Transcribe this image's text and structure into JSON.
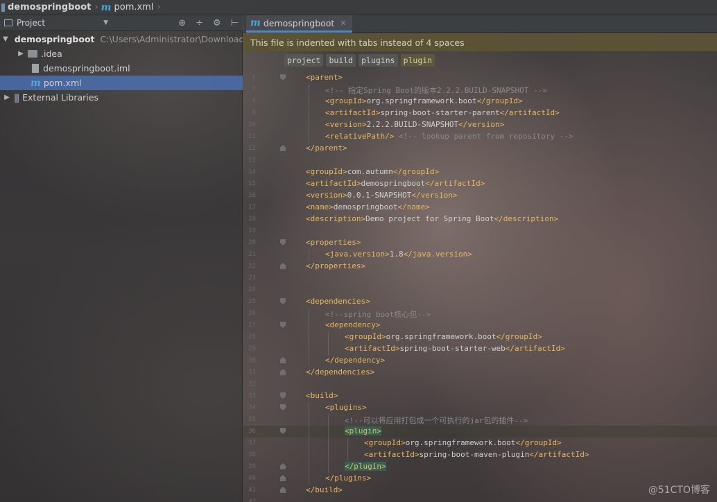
{
  "navbar": {
    "project": "demospringboot",
    "file": "pom.xml"
  },
  "project_panel": {
    "title": "Project",
    "tree": [
      {
        "kind": "project",
        "label": "demospringboot",
        "path": "C:\\Users\\Administrator\\Download",
        "expanded": true
      },
      {
        "kind": "folder",
        "label": ".idea",
        "expanded": false
      },
      {
        "kind": "iml",
        "label": "demospringboot.iml"
      },
      {
        "kind": "maven",
        "label": "pom.xml",
        "selected": true
      },
      {
        "kind": "libraries",
        "label": "External Libraries",
        "expanded": false
      }
    ]
  },
  "editor": {
    "tab": "demospringboot",
    "banner": "This file is indented with tabs instead of 4 spaces",
    "breadcrumbs": [
      "project",
      "build",
      "plugins",
      "plugin"
    ],
    "lines": [
      {
        "n": "6",
        "indent": 0,
        "fold": "start",
        "parts": [
          [
            "tag",
            "<parent>"
          ]
        ]
      },
      {
        "n": "7",
        "indent": 1,
        "parts": [
          [
            "cm",
            "<!-- 指定Spring Boot的版本2.2.2.BUILD-SNAPSHOT -->"
          ]
        ]
      },
      {
        "n": "8",
        "indent": 1,
        "parts": [
          [
            "tag",
            "<groupId>"
          ],
          [
            "tx",
            "org.springframework.boot"
          ],
          [
            "tag",
            "</groupId>"
          ]
        ]
      },
      {
        "n": "9",
        "indent": 1,
        "parts": [
          [
            "tag",
            "<artifactId>"
          ],
          [
            "tx",
            "spring-boot-starter-parent"
          ],
          [
            "tag",
            "</artifactId>"
          ]
        ]
      },
      {
        "n": "10",
        "indent": 1,
        "parts": [
          [
            "tag",
            "<version>"
          ],
          [
            "tx",
            "2.2.2.BUILD-SNAPSHOT"
          ],
          [
            "tag",
            "</version>"
          ]
        ]
      },
      {
        "n": "11",
        "indent": 1,
        "parts": [
          [
            "tag",
            "<relativePath/>"
          ],
          [
            "tx",
            " "
          ],
          [
            "cm",
            "<!-- lookup parent from repository -->"
          ]
        ]
      },
      {
        "n": "12",
        "indent": 0,
        "fold": "end",
        "parts": [
          [
            "tag",
            "</parent>"
          ]
        ]
      },
      {
        "n": "13",
        "indent": 0,
        "parts": []
      },
      {
        "n": "14",
        "indent": 0,
        "parts": [
          [
            "tag",
            "<groupId>"
          ],
          [
            "tx",
            "com.autumn"
          ],
          [
            "tag",
            "</groupId>"
          ]
        ]
      },
      {
        "n": "15",
        "indent": 0,
        "parts": [
          [
            "tag",
            "<artifactId>"
          ],
          [
            "tx",
            "demospringboot"
          ],
          [
            "tag",
            "</artifactId>"
          ]
        ]
      },
      {
        "n": "16",
        "indent": 0,
        "parts": [
          [
            "tag",
            "<version>"
          ],
          [
            "tx",
            "0.0.1-SNAPSHOT"
          ],
          [
            "tag",
            "</version>"
          ]
        ]
      },
      {
        "n": "17",
        "indent": 0,
        "parts": [
          [
            "tag",
            "<name>"
          ],
          [
            "tx",
            "demospringboot"
          ],
          [
            "tag",
            "</name>"
          ]
        ]
      },
      {
        "n": "18",
        "indent": 0,
        "parts": [
          [
            "tag",
            "<description>"
          ],
          [
            "tx",
            "Demo project for Spring Boot"
          ],
          [
            "tag",
            "</description>"
          ]
        ]
      },
      {
        "n": "19",
        "indent": 0,
        "parts": []
      },
      {
        "n": "20",
        "indent": 0,
        "fold": "start",
        "parts": [
          [
            "tag",
            "<properties>"
          ]
        ]
      },
      {
        "n": "21",
        "indent": 1,
        "parts": [
          [
            "tag",
            "<java.version>"
          ],
          [
            "tx",
            "1.8"
          ],
          [
            "tag",
            "</java.version>"
          ]
        ]
      },
      {
        "n": "22",
        "indent": 0,
        "fold": "end",
        "parts": [
          [
            "tag",
            "</properties>"
          ]
        ]
      },
      {
        "n": "23",
        "indent": 0,
        "parts": []
      },
      {
        "n": "24",
        "indent": 0,
        "parts": []
      },
      {
        "n": "25",
        "indent": 0,
        "fold": "start",
        "parts": [
          [
            "tag",
            "<dependencies>"
          ]
        ]
      },
      {
        "n": "26",
        "indent": 1,
        "parts": [
          [
            "cm",
            "<!--spring boot核心包-->"
          ]
        ]
      },
      {
        "n": "27",
        "indent": 1,
        "fold": "start",
        "parts": [
          [
            "tag",
            "<dependency>"
          ]
        ]
      },
      {
        "n": "28",
        "indent": 2,
        "parts": [
          [
            "tag",
            "<groupId>"
          ],
          [
            "tx",
            "org.springframework.boot"
          ],
          [
            "tag",
            "</groupId>"
          ]
        ]
      },
      {
        "n": "29",
        "indent": 2,
        "parts": [
          [
            "tag",
            "<artifactId>"
          ],
          [
            "tx",
            "spring-boot-starter-web"
          ],
          [
            "tag",
            "</artifactId>"
          ]
        ]
      },
      {
        "n": "30",
        "indent": 1,
        "fold": "end",
        "parts": [
          [
            "tag",
            "</dependency>"
          ]
        ]
      },
      {
        "n": "31",
        "indent": 0,
        "fold": "end",
        "parts": [
          [
            "tag",
            "</dependencies>"
          ]
        ]
      },
      {
        "n": "32",
        "indent": 0,
        "parts": []
      },
      {
        "n": "33",
        "indent": 0,
        "fold": "start",
        "parts": [
          [
            "tag",
            "<build>"
          ]
        ]
      },
      {
        "n": "34",
        "indent": 1,
        "fold": "start",
        "parts": [
          [
            "tag",
            "<plugins>"
          ]
        ]
      },
      {
        "n": "35",
        "indent": 2,
        "parts": [
          [
            "cm",
            "<!--可以将应用打包成一个可执行的jar包的插件-->"
          ]
        ]
      },
      {
        "n": "36",
        "indent": 2,
        "fold": "start",
        "caret": true,
        "parts": [
          [
            "hl",
            "<plugin>"
          ]
        ]
      },
      {
        "n": "37",
        "indent": 3,
        "parts": [
          [
            "tag",
            "<groupId>"
          ],
          [
            "tx",
            "org.springframework.boot"
          ],
          [
            "tag",
            "</groupId>"
          ]
        ]
      },
      {
        "n": "38",
        "indent": 3,
        "parts": [
          [
            "tag",
            "<artifactId>"
          ],
          [
            "tx",
            "spring-boot-maven-plugin"
          ],
          [
            "tag",
            "</artifactId>"
          ]
        ]
      },
      {
        "n": "39",
        "indent": 2,
        "fold": "end",
        "parts": [
          [
            "hl",
            "</plugin>"
          ]
        ]
      },
      {
        "n": "40",
        "indent": 1,
        "fold": "end",
        "parts": [
          [
            "tag",
            "</plugins>"
          ]
        ]
      },
      {
        "n": "41",
        "indent": 0,
        "fold": "end",
        "parts": [
          [
            "tag",
            "</build>"
          ]
        ]
      },
      {
        "n": "42",
        "indent": 0,
        "parts": []
      }
    ]
  },
  "watermark": "@51CTO博客"
}
